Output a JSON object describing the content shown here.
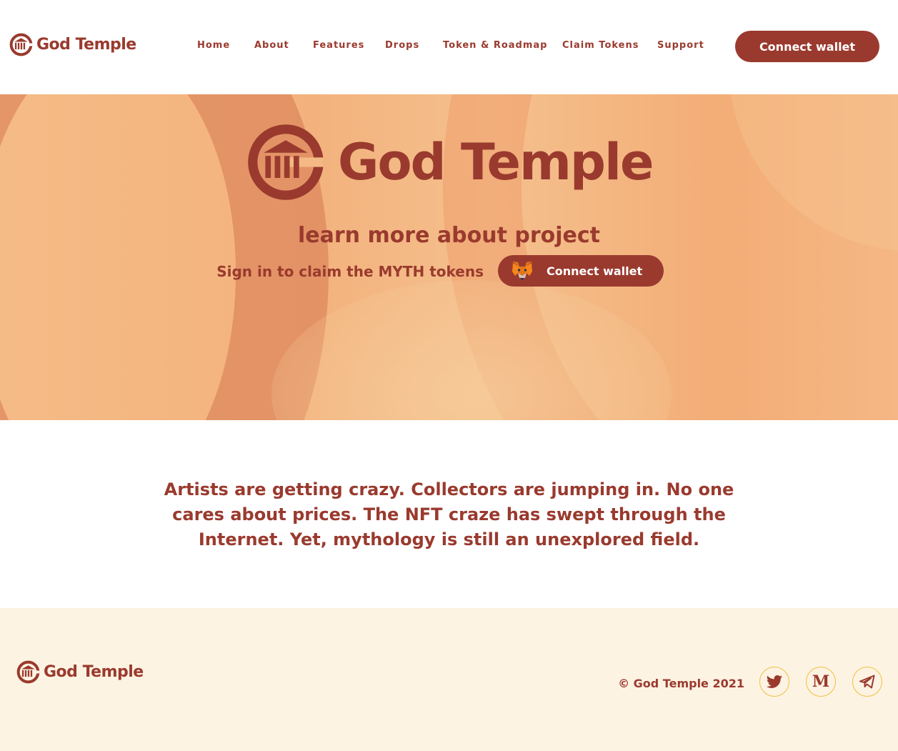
{
  "brand": {
    "name": "God Temple",
    "color": "#9a3a2e"
  },
  "nav": {
    "items": [
      "Home",
      "About",
      "Features",
      "Drops",
      "Token & Roadmap",
      "Claim Tokens",
      "Support"
    ]
  },
  "header": {
    "connect_label": "Connect wallet"
  },
  "hero": {
    "heading": "learn more about project",
    "subtext": "Sign in to claim the MYTH tokens",
    "connect_label": "Connect wallet",
    "button_icon": "metamask-fox-icon"
  },
  "intro": {
    "text": "Artists are getting crazy. Collectors are jumping in. No one cares about prices. The NFT craze has swept through the Internet. Yet, mythology is still an unexplored field."
  },
  "footer": {
    "copyright": "© God Temple 2021",
    "social": [
      "twitter-icon",
      "medium-icon",
      "telegram-icon"
    ]
  }
}
